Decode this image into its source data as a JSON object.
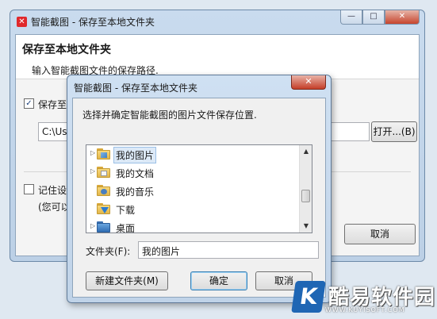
{
  "main_window": {
    "title": "智能截图 - 保存至本地文件夹",
    "app_icon_glyph": "✕",
    "controls": {
      "minimize": "—",
      "maximize": "□",
      "close": "✕"
    },
    "heading": "保存至本地文件夹",
    "subheading": "输入智能截图文件的保存路径.",
    "save_checkbox": {
      "label": "保存至",
      "checked": true
    },
    "path_value": "C:\\Use",
    "open_button": "打开...(B)",
    "remember_checkbox": {
      "label": "记住设置",
      "checked": false
    },
    "note": "(您可以",
    "cancel_button": "取消"
  },
  "dialog": {
    "title": "智能截图 - 保存至本地文件夹",
    "close": "✕",
    "description": "选择并确定智能截图的图片文件保存位置.",
    "tree": [
      {
        "label": "我的图片",
        "expandable": true,
        "selected": true,
        "icon": "pictures-folder-icon"
      },
      {
        "label": "我的文档",
        "expandable": true,
        "selected": false,
        "icon": "documents-folder-icon"
      },
      {
        "label": "我的音乐",
        "expandable": false,
        "selected": false,
        "icon": "music-folder-icon"
      },
      {
        "label": "下载",
        "expandable": false,
        "selected": false,
        "icon": "downloads-folder-icon"
      },
      {
        "label": "桌面",
        "expandable": true,
        "selected": false,
        "icon": "desktop-folder-icon"
      }
    ],
    "folder_label": "文件夹(F):",
    "folder_value": "我的图片",
    "new_folder_button": "新建文件夹(M)",
    "ok_button": "确定",
    "cancel_button": "取消"
  },
  "watermark": {
    "logo_glyph": "K",
    "text": "酷易软件园",
    "url": "WWW.KUYISOFT.COM"
  },
  "colors": {
    "title_close_red": "#c43e28",
    "accent_blue": "#1f66b4"
  }
}
